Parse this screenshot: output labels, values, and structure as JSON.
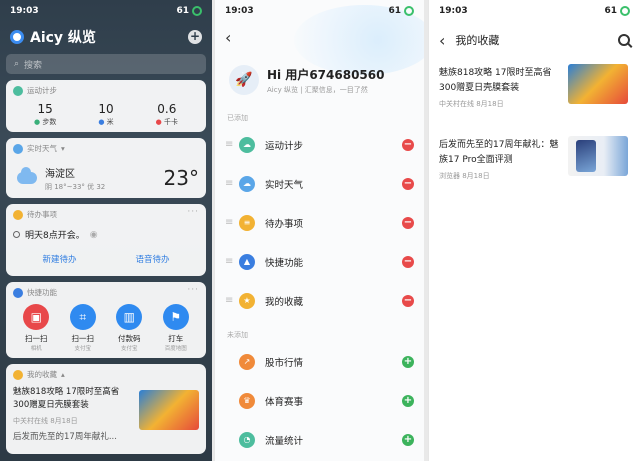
{
  "status": {
    "time": "19:03",
    "battery": "61"
  },
  "panel1": {
    "title": "Aicy 纵览",
    "search_placeholder": "搜索",
    "steps": {
      "header": "运动计步",
      "values": [
        {
          "num": "15",
          "label": "步数"
        },
        {
          "num": "10",
          "label": "米"
        },
        {
          "num": "0.6",
          "label": "千卡"
        }
      ]
    },
    "weather": {
      "header": "实时天气",
      "location": "海淀区",
      "range": "阴 18°~33° 优 32",
      "temp": "23°"
    },
    "todo": {
      "header": "待办事项",
      "item": "明天8点开会。",
      "new_btn": "新建待办",
      "voice_btn": "语音待办"
    },
    "quick": {
      "header": "快捷功能",
      "items": [
        {
          "label": "扫一扫",
          "sub": "相机",
          "color": "#e8484a",
          "glyph": "▣"
        },
        {
          "label": "扫一扫",
          "sub": "支付宝",
          "color": "#2f8af0",
          "glyph": "⌗"
        },
        {
          "label": "付款码",
          "sub": "支付宝",
          "color": "#2f8af0",
          "glyph": "▥"
        },
        {
          "label": "打车",
          "sub": "百度地图",
          "color": "#2f8af0",
          "glyph": "⚑"
        }
      ]
    },
    "favorites": {
      "header": "我的收藏",
      "title": "魅族818攻略 17限时至高省300赠夏日壳膜套装",
      "meta": "中关村在线 8月18日",
      "next_title": "后发而先至的17周年献礼..."
    }
  },
  "panel2": {
    "user": "Hi 用户674680560",
    "user_sub": "Aicy 纵览 | 汇聚信息，一目了然",
    "added_label": "已添加",
    "added": [
      {
        "label": "运动计步",
        "color": "#4dbd9e",
        "glyph": "☁"
      },
      {
        "label": "实时天气",
        "color": "#5aa6e8",
        "glyph": "☁"
      },
      {
        "label": "待办事项",
        "color": "#f2b233",
        "glyph": "≡"
      },
      {
        "label": "快捷功能",
        "color": "#3a7ee0",
        "glyph": "▲"
      },
      {
        "label": "我的收藏",
        "color": "#f2b233",
        "glyph": "★"
      }
    ],
    "unadded_label": "未添加",
    "unadded": [
      {
        "label": "股市行情",
        "color": "#f08a3a",
        "glyph": "↗"
      },
      {
        "label": "体育赛事",
        "color": "#f08a3a",
        "glyph": "♛"
      },
      {
        "label": "流量统计",
        "color": "#4dbd9e",
        "glyph": "◔"
      }
    ]
  },
  "panel3": {
    "title": "我的收藏",
    "articles": [
      {
        "title": "魅族818攻略 17限时至高省300赠夏日壳膜套装",
        "meta": "中关村在线 8月18日"
      },
      {
        "title": "后发而先至的17周年献礼：魅族17 Pro全面评测",
        "meta": "浏览器 8月18日"
      }
    ]
  }
}
